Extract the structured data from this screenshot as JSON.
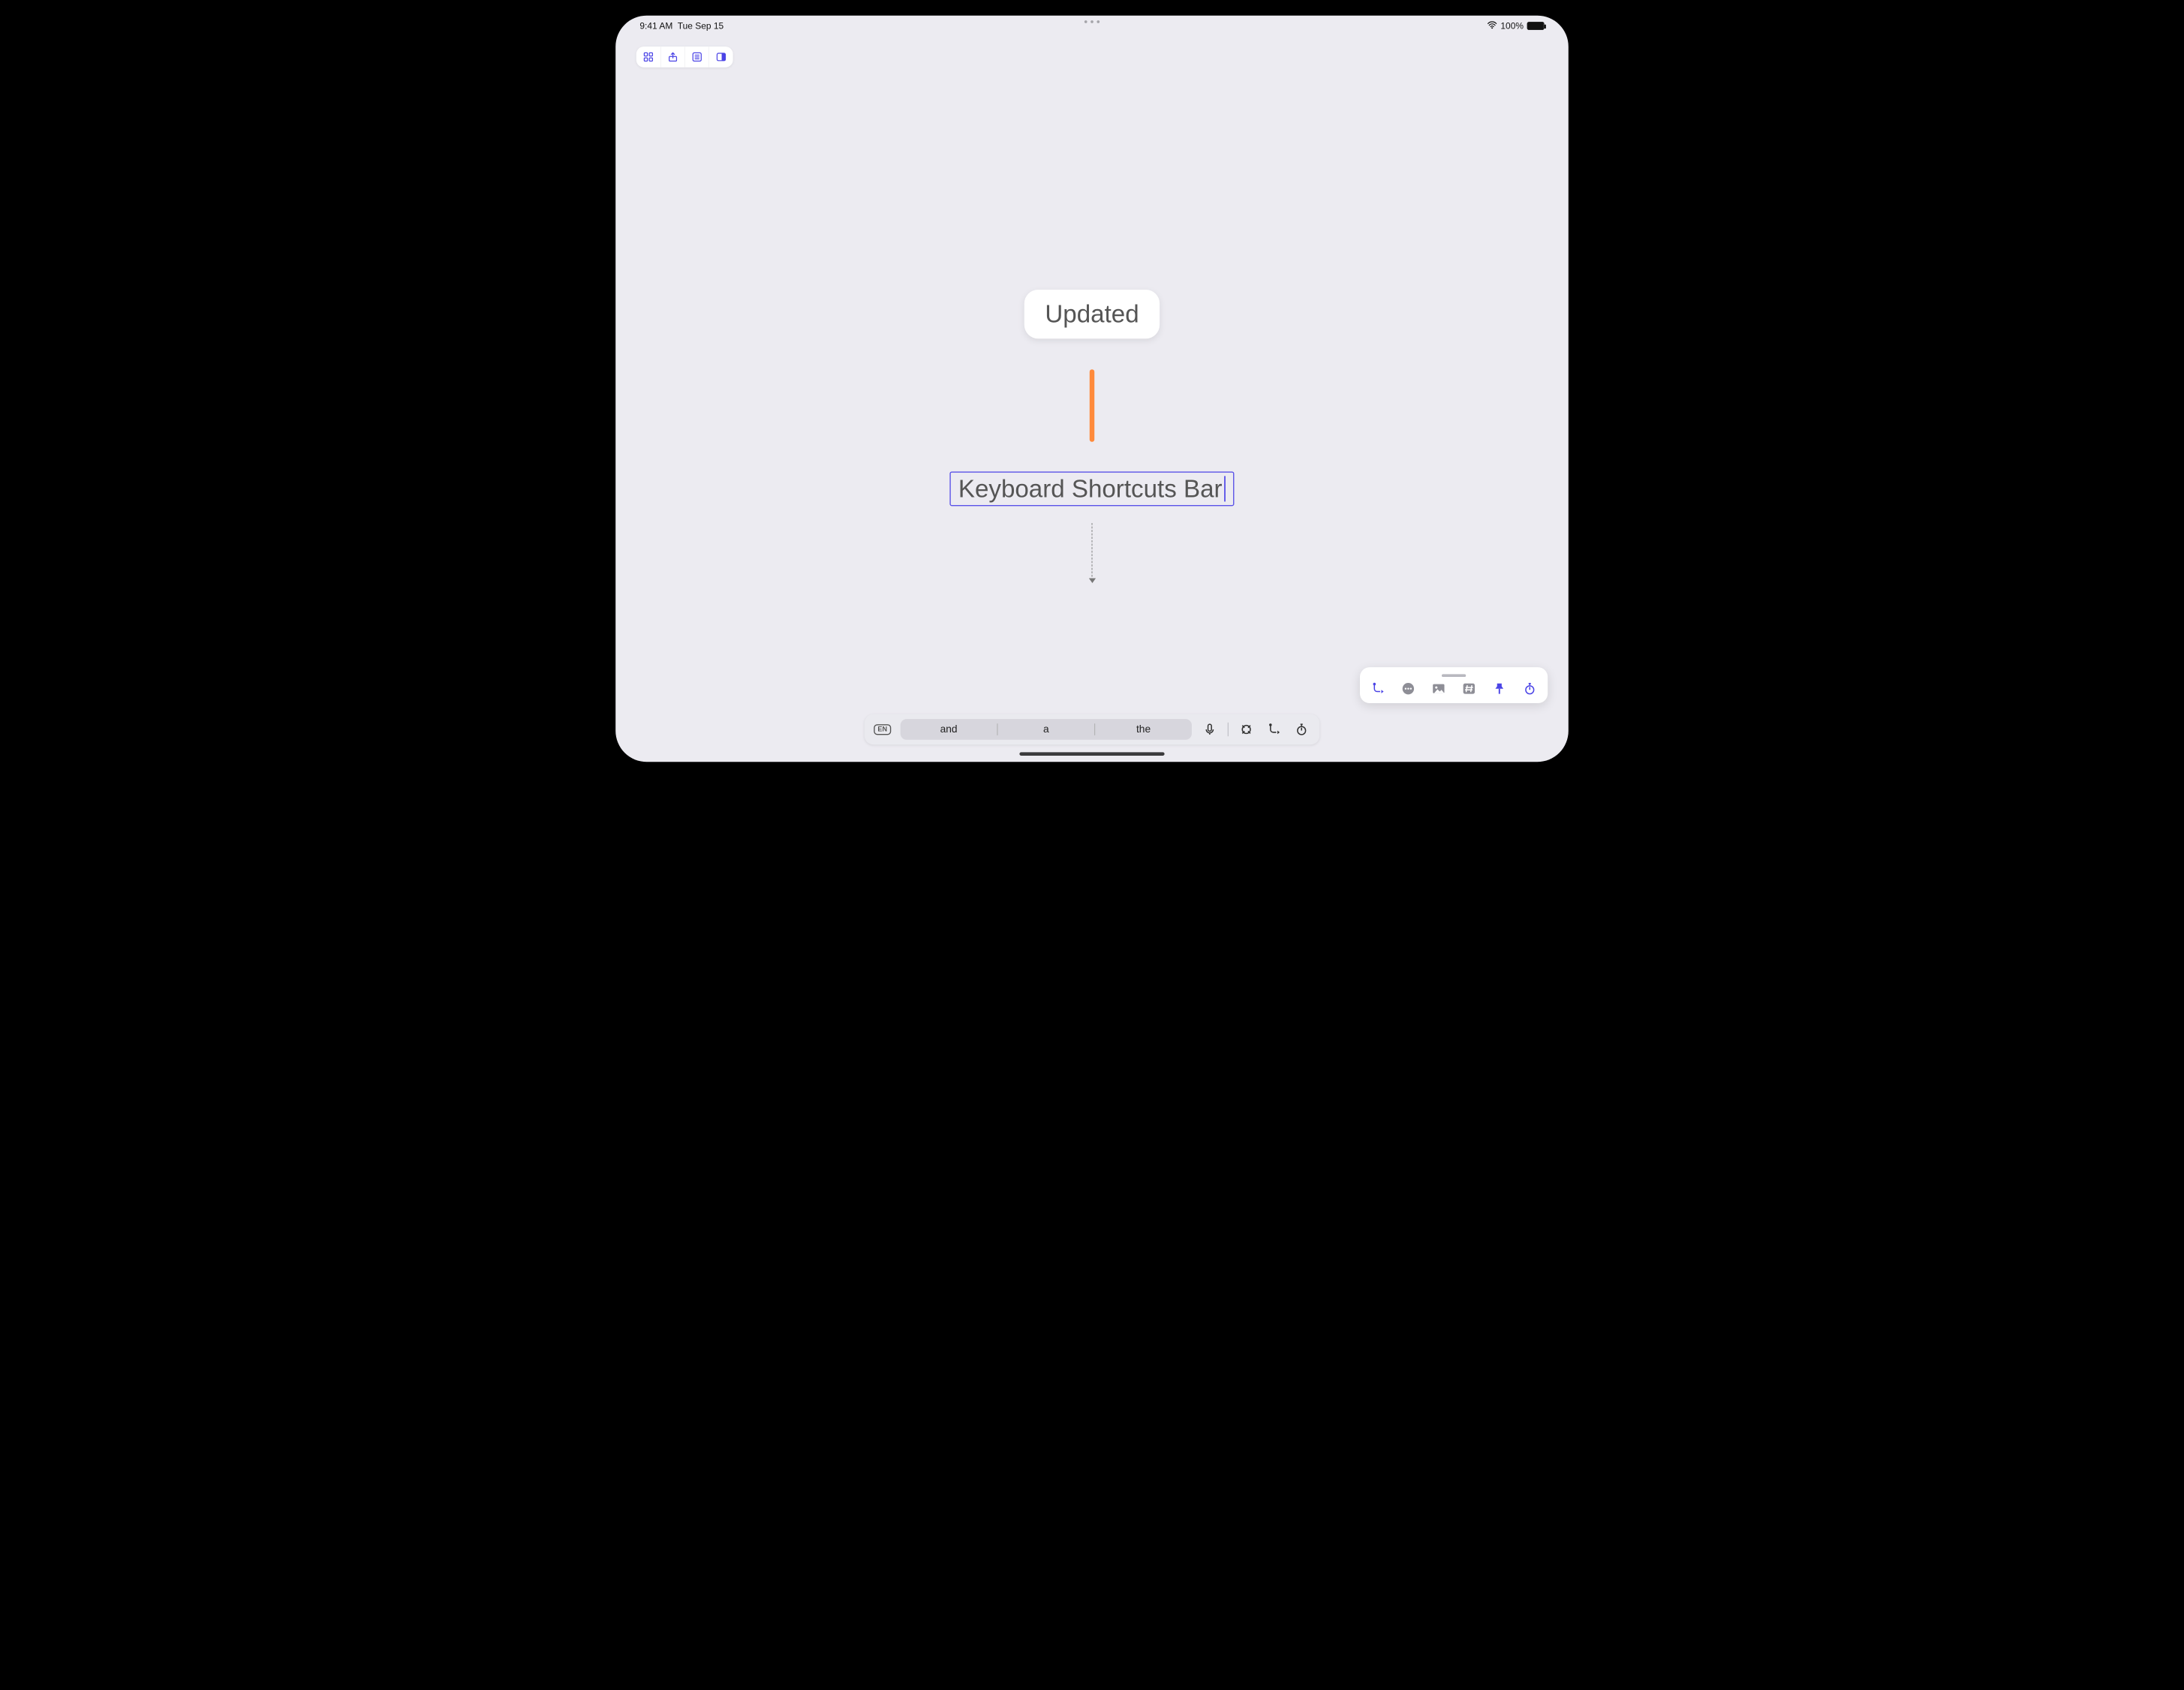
{
  "status": {
    "time": "9:41 AM",
    "date": "Tue Sep 15",
    "battery_percent": "100%"
  },
  "toolbar": {
    "icons": [
      "grid-icon",
      "share-icon",
      "list-icon",
      "sidebar-icon"
    ]
  },
  "nodes": {
    "parent_label": "Updated",
    "editing_label": "Keyboard Shortcuts Bar "
  },
  "palette": {
    "icons": [
      "add-child-icon",
      "more-icon",
      "image-icon",
      "hash-icon",
      "pin-icon",
      "stopwatch-icon"
    ]
  },
  "ksb": {
    "language": "EN",
    "predictions": [
      "and",
      "a",
      "the"
    ],
    "right_icons": [
      "mic-icon",
      "target-icon",
      "add-child-icon",
      "stopwatch-icon"
    ]
  },
  "colors": {
    "accent": "#4b44e6",
    "connector": "#ff8a3b",
    "background": "#ECEBF1"
  }
}
